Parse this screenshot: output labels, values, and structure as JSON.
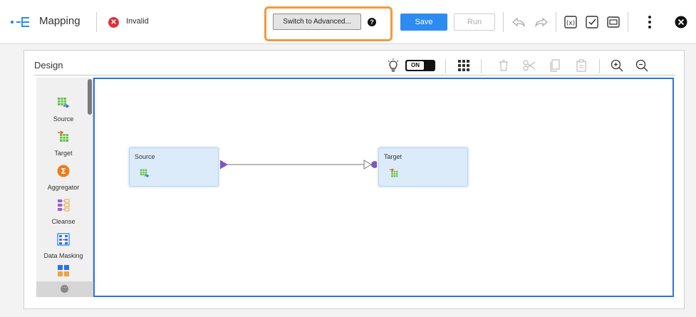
{
  "toolbar": {
    "app_title": "Mapping",
    "status": "Invalid",
    "switch_advanced_label": "Switch to Advanced...",
    "save_label": "Save",
    "run_label": "Run"
  },
  "design": {
    "title": "Design",
    "toggle_label": "ON"
  },
  "palette": {
    "items": [
      {
        "label": "Source",
        "icon": "source-icon"
      },
      {
        "label": "Target",
        "icon": "target-icon"
      },
      {
        "label": "Aggregator",
        "icon": "aggregator-icon"
      },
      {
        "label": "Cleanse",
        "icon": "cleanse-icon"
      },
      {
        "label": "Data Masking",
        "icon": "data-masking-icon"
      }
    ]
  },
  "canvas": {
    "nodes": [
      {
        "label": "Source",
        "icon": "source-icon"
      },
      {
        "label": "Target",
        "icon": "target-icon"
      }
    ]
  },
  "colors": {
    "accent": "#2d8cf0",
    "highlight": "#f39a3d",
    "invalid": "#e0303f",
    "canvas_border": "#2d73e0",
    "node_fill": "#dcebfa",
    "link": "#7e57c2"
  }
}
